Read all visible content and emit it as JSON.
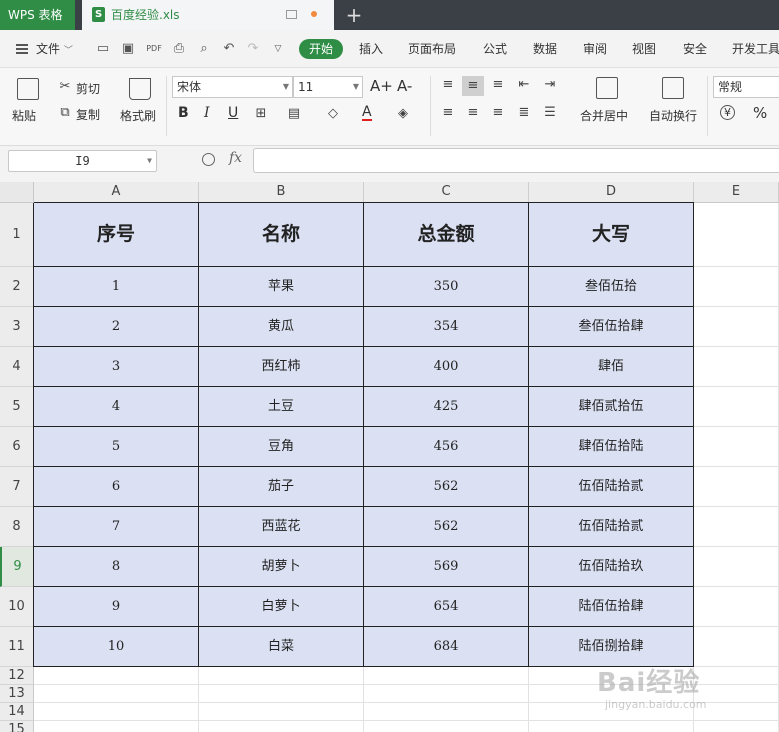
{
  "titlebar": {
    "app_name": "WPS 表格",
    "file_name": "百度经验.xls",
    "new_tab": "+"
  },
  "menubar": {
    "file_menu": "文件",
    "tabs": [
      "开始",
      "插入",
      "页面布局",
      "公式",
      "数据",
      "审阅",
      "视图",
      "安全",
      "开发工具"
    ]
  },
  "ribbon": {
    "paste": "粘贴",
    "cut": "剪切",
    "copy": "复制",
    "format_painter": "格式刷",
    "font_name": "宋体",
    "font_size": "11",
    "bold": "B",
    "italic": "I",
    "underline": "U",
    "font_color_letter": "A",
    "grow_font": "A+",
    "shrink_font": "A-",
    "merge_center": "合并居中",
    "wrap_text": "自动换行",
    "number_format": "常规",
    "currency": "¥",
    "percent": "%"
  },
  "formula_bar": {
    "cell_ref": "I9",
    "fx": "fx",
    "value": ""
  },
  "columns": [
    "A",
    "B",
    "C",
    "D",
    "E"
  ],
  "rows": [
    "1",
    "2",
    "3",
    "4",
    "5",
    "6",
    "7",
    "8",
    "9",
    "10",
    "11",
    "12",
    "13",
    "14",
    "15"
  ],
  "selected_row": "9",
  "table": {
    "headers": [
      "序号",
      "名称",
      "总金额",
      "大写"
    ],
    "rows": [
      [
        "1",
        "苹果",
        "350",
        "叁佰伍拾"
      ],
      [
        "2",
        "黄瓜",
        "354",
        "叁佰伍拾肆"
      ],
      [
        "3",
        "西红柿",
        "400",
        "肆佰"
      ],
      [
        "4",
        "土豆",
        "425",
        "肆佰贰拾伍"
      ],
      [
        "5",
        "豆角",
        "456",
        "肆佰伍拾陆"
      ],
      [
        "6",
        "茄子",
        "562",
        "伍佰陆拾贰"
      ],
      [
        "7",
        "西蓝花",
        "562",
        "伍佰陆拾贰"
      ],
      [
        "8",
        "胡萝卜",
        "569",
        "伍佰陆拾玖"
      ],
      [
        "9",
        "白萝卜",
        "654",
        "陆佰伍拾肆"
      ],
      [
        "10",
        "白菜",
        "684",
        "陆佰捌拾肆"
      ]
    ]
  },
  "colors": {
    "accent": "#2f8d46",
    "table_fill": "#dbe1f3",
    "titlebar": "#3b3f46"
  },
  "watermark": {
    "line1": "Bai经验",
    "line2": "jingyan.baidu.com"
  }
}
